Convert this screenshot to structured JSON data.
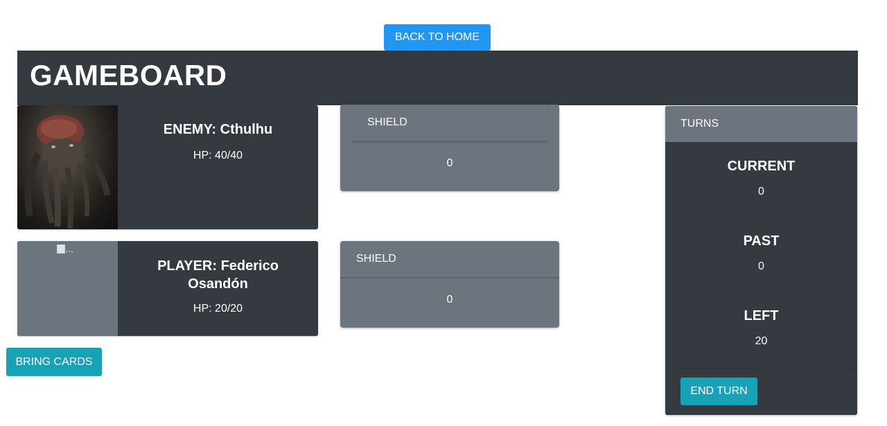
{
  "nav": {
    "back_home_label": "BACK TO HOME"
  },
  "header": {
    "title": "GAMEBOARD"
  },
  "enemy": {
    "name_label": "ENEMY: Cthulhu",
    "hp_label": "HP: 40/40",
    "shield_title": "SHIELD",
    "shield_value": "0"
  },
  "player": {
    "image_alt": "...",
    "name_label": "PLAYER: Federico Osandón",
    "hp_label": "HP: 20/20",
    "shield_title": "SHIELD",
    "shield_value": "0"
  },
  "actions": {
    "bring_cards_label": "BRING CARDS"
  },
  "turns": {
    "title": "TURNS",
    "current_label": "CURRENT",
    "current_value": "0",
    "past_label": "PAST",
    "past_value": "0",
    "left_label": "LEFT",
    "left_value": "20",
    "end_turn_label": "END TURN"
  },
  "colors": {
    "primary": "#2196f3",
    "info": "#17a2b8",
    "dark": "#343a40",
    "secondary": "#6c757d"
  }
}
